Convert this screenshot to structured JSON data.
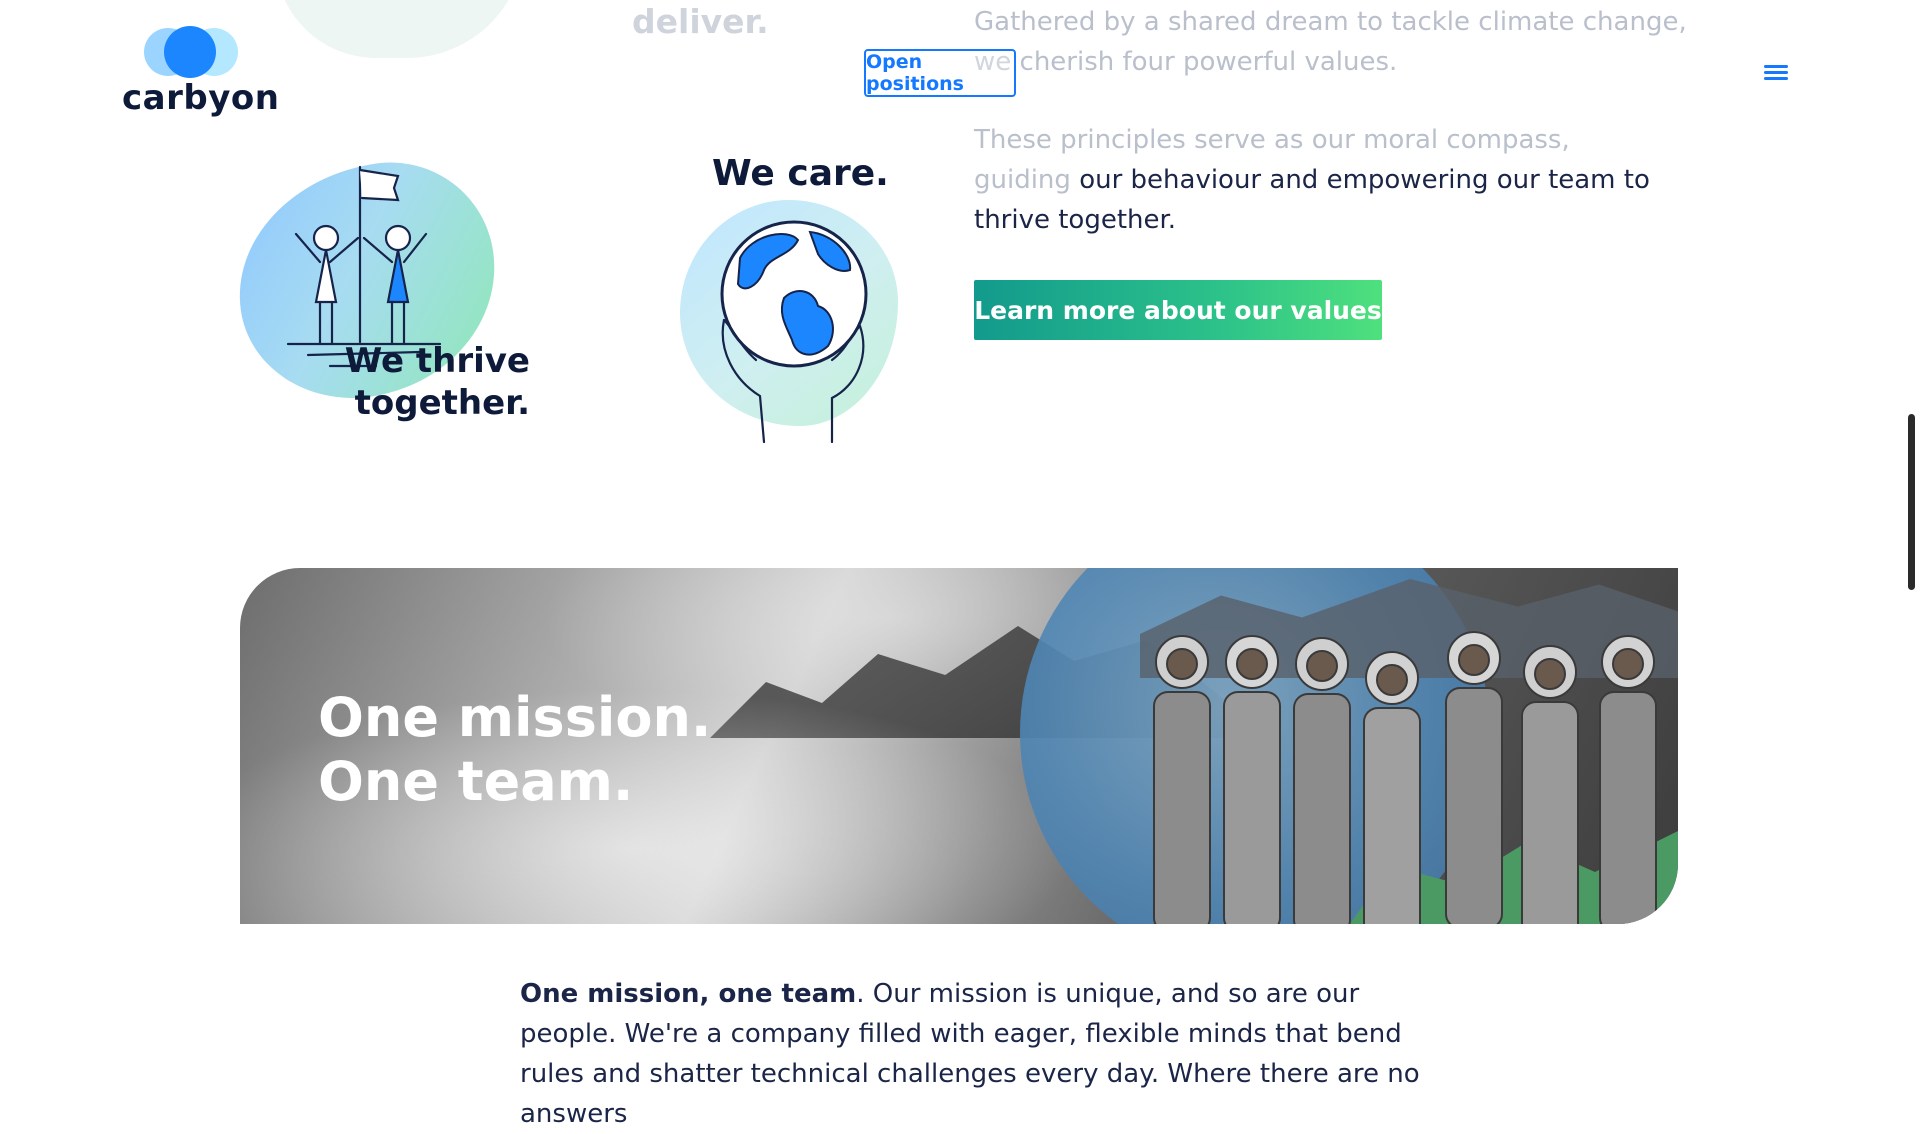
{
  "header": {
    "logo_text": "carbyon",
    "open_positions_label": "Open positions",
    "menu_icon": "hamburger-icon"
  },
  "faded_section": {
    "heading_fragment": "deliver.",
    "paragraph1": "Gathered by a shared dream to tackle climate change, we cherish four powerful values.",
    "paragraph2_faded": "These principles serve as our moral compass, guiding",
    "paragraph2_rest": "our behaviour and empowering our team to thrive together."
  },
  "values": {
    "thrive_label": "We thrive together.",
    "care_label": "We care.",
    "learn_more_label": "Learn more about our values"
  },
  "banner": {
    "line1": "One mission.",
    "line2": "One team."
  },
  "body": {
    "bold_lead": "One mission, one team",
    "text": ". Our mission is unique, and so are our people. We're a company filled with eager, flexible minds that bend rules and shatter technical challenges every day. Where there are no answers"
  },
  "colors": {
    "brand_blue": "#1479ff",
    "navy_text": "#0e1a3a",
    "gradient_start": "#129a8c",
    "gradient_end": "#4fe07d"
  }
}
